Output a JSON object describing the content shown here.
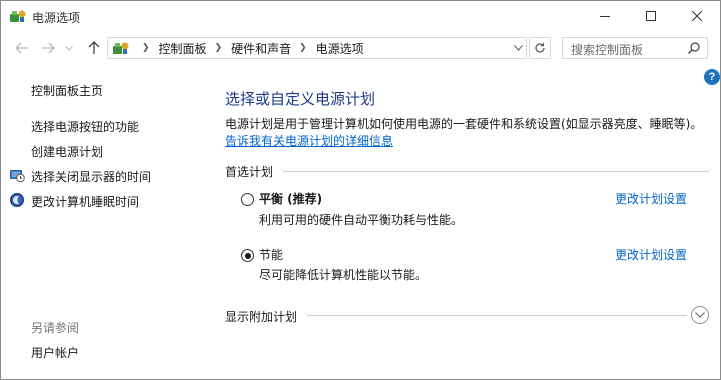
{
  "window": {
    "title": "电源选项",
    "icon": "power-options-icon"
  },
  "address_bar": {
    "crumbs": [
      "控制面板",
      "硬件和声音",
      "电源选项"
    ],
    "search_placeholder": "搜索控制面板"
  },
  "sidebar": {
    "home": "控制面板主页",
    "links": [
      {
        "label": "选择电源按钮的功能",
        "icon": null
      },
      {
        "label": "创建电源计划",
        "icon": null
      },
      {
        "label": "选择关闭显示器的时间",
        "icon": "display-clock-icon"
      },
      {
        "label": "更改计算机睡眠时间",
        "icon": "sleep-moon-icon"
      }
    ],
    "see_also_heading": "另请参阅",
    "see_also": [
      {
        "label": "用户帐户"
      }
    ]
  },
  "main": {
    "title": "选择或自定义电源计划",
    "description": "电源计划是用于管理计算机如何使用电源的一套硬件和系统设置(如显示器亮度、睡眠等)。",
    "more_info_link": "告诉我有关电源计划的详细信息",
    "preferred_plans_heading": "首选计划",
    "plans": [
      {
        "name": "平衡 (推荐)",
        "description": "利用可用的硬件自动平衡功耗与性能。",
        "selected": false,
        "change_link": "更改计划设置"
      },
      {
        "name": "节能",
        "description": "尽可能降低计算机性能以节能。",
        "selected": true,
        "change_link": "更改计划设置"
      }
    ],
    "additional_plans_heading": "显示附加计划"
  },
  "colors": {
    "title_blue": "#1e3a8a",
    "link_blue": "#0066cc",
    "help_blue": "#1e73be"
  }
}
